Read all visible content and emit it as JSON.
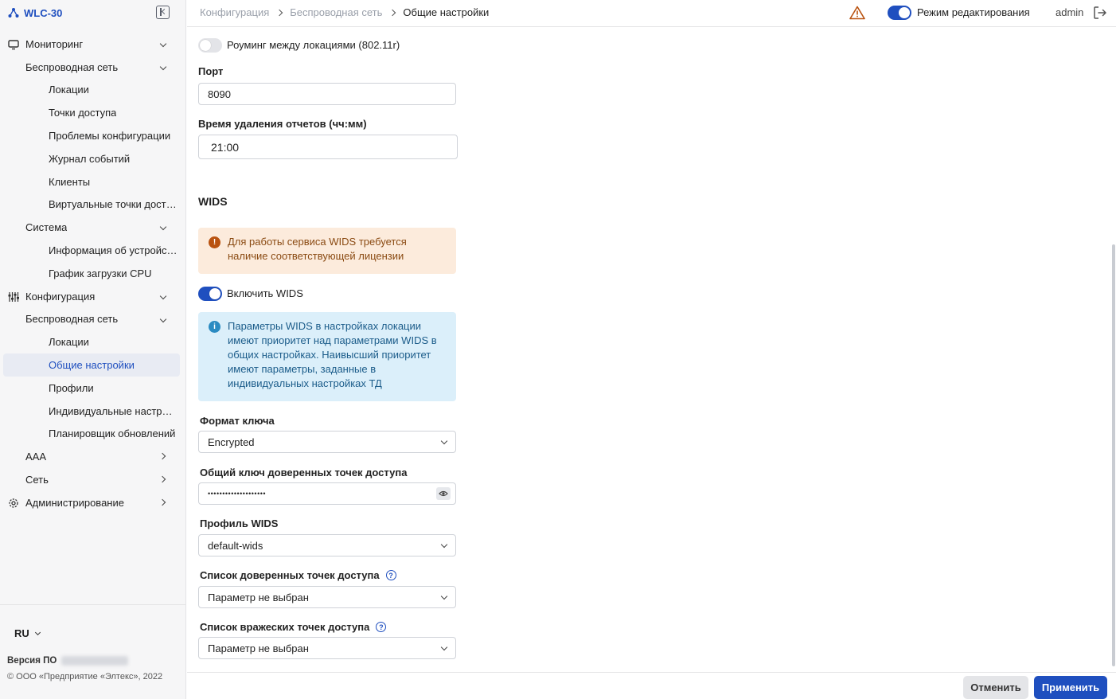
{
  "app": {
    "title": "WLC-30"
  },
  "sidebar": {
    "items": [
      {
        "label": "Мониторинг",
        "level": 0,
        "icon": "monitor-icon",
        "chevron": "down"
      },
      {
        "label": "Беспроводная сеть",
        "level": 1,
        "chevron": "down"
      },
      {
        "label": "Локации",
        "level": 2
      },
      {
        "label": "Точки доступа",
        "level": 2
      },
      {
        "label": "Проблемы конфигурации",
        "level": 2
      },
      {
        "label": "Журнал событий",
        "level": 2
      },
      {
        "label": "Клиенты",
        "level": 2
      },
      {
        "label": "Виртуальные точки доступа",
        "level": 2
      },
      {
        "label": "Система",
        "level": 1,
        "chevron": "down"
      },
      {
        "label": "Информация об устройстве",
        "level": 2
      },
      {
        "label": "График загрузки CPU",
        "level": 2
      },
      {
        "label": "Конфигурация",
        "level": 0,
        "icon": "sliders-icon",
        "chevron": "down"
      },
      {
        "label": "Беспроводная сеть",
        "level": 1,
        "chevron": "down"
      },
      {
        "label": "Локации",
        "level": 2
      },
      {
        "label": "Общие настройки",
        "level": 2,
        "active": true
      },
      {
        "label": "Профили",
        "level": 2
      },
      {
        "label": "Индивидуальные настройки",
        "level": 2
      },
      {
        "label": "Планировщик обновлений",
        "level": 2
      },
      {
        "label": "AAA",
        "level": 1,
        "chevron": "right"
      },
      {
        "label": "Сеть",
        "level": 1,
        "chevron": "right"
      },
      {
        "label": "Администрирование",
        "level": 0,
        "icon": "gear-icon",
        "chevron": "right"
      }
    ],
    "language": "RU",
    "version_label": "Версия ПО",
    "copyright": "© ООО «Предприятие «Элтекс», 2022"
  },
  "header": {
    "breadcrumb": [
      "Конфигурация",
      "Беспроводная сеть",
      "Общие настройки"
    ],
    "edit_mode_label": "Режим редактирования",
    "user": "admin"
  },
  "form": {
    "roaming_label": "Роуминг между локациями (802.11r)",
    "port_label": "Порт",
    "port_value": "8090",
    "report_time_label": "Время удаления отчетов (чч:мм)",
    "report_time_value": "21:00",
    "wids_title": "WIDS",
    "wids_license_alert": "Для работы сервиса WIDS требуется наличие соответствующей лицензии",
    "enable_wids_label": "Включить WIDS",
    "wids_info_alert": "Параметры WIDS в настройках локации имеют приоритет над параметрами WIDS в общих настройках. Наивысший приоритет имеют параметры, заданные в индивидуальных настройках ТД",
    "key_format_label": "Формат ключа",
    "key_format_value": "Encrypted",
    "shared_key_label": "Общий ключ доверенных точек доступа",
    "shared_key_value": "••••••••••••••••••••",
    "wids_profile_label": "Профиль WIDS",
    "wids_profile_value": "default-wids",
    "trusted_list_label": "Список доверенных точек доступа",
    "trusted_list_value": "Параметр не выбран",
    "rogue_list_label": "Список вражеских точек доступа",
    "rogue_list_value": "Параметр не выбран"
  },
  "actions": {
    "cancel": "Отменить",
    "apply": "Применить"
  },
  "colors": {
    "accent": "#1f4fbf",
    "warning_bg": "#fcebdc",
    "info_bg": "#dbeffa"
  }
}
